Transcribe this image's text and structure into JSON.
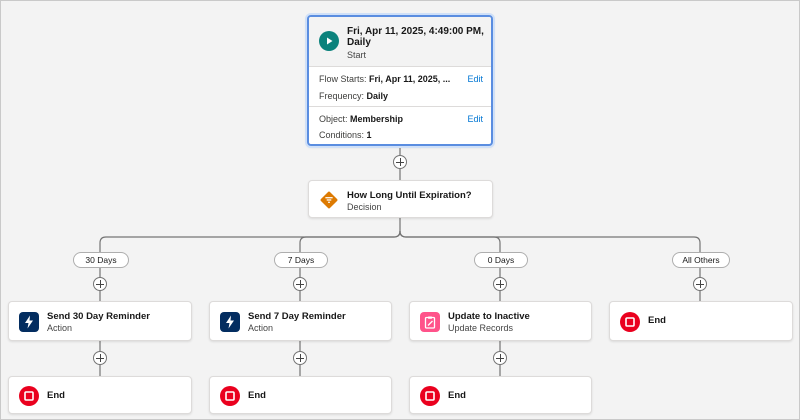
{
  "start": {
    "title": "Fri, Apr 11, 2025, 4:49:00 PM, Daily",
    "subtitle": "Start",
    "icon": "play-icon",
    "flow_starts_label": "Flow Starts:",
    "flow_starts_value": "Fri, Apr 11, 2025, ...",
    "frequency_label": "Frequency:",
    "frequency_value": "Daily",
    "object_label": "Object:",
    "object_value": "Membership",
    "conditions_label": "Conditions:",
    "conditions_value": "1",
    "edit_label": "Edit"
  },
  "decision": {
    "title": "How Long Until Expiration?",
    "subtitle": "Decision",
    "icon": "decision-icon"
  },
  "branches": [
    {
      "label": "30 Days",
      "element": {
        "title": "Send 30 Day Reminder",
        "subtitle": "Action",
        "icon": "lightning-icon"
      },
      "end_label": "End"
    },
    {
      "label": "7 Days",
      "element": {
        "title": "Send 7 Day Reminder",
        "subtitle": "Action",
        "icon": "lightning-icon"
      },
      "end_label": "End"
    },
    {
      "label": "0 Days",
      "element": {
        "title": "Update to Inactive",
        "subtitle": "Update Records",
        "icon": "update-records-icon"
      },
      "end_label": "End"
    },
    {
      "label": "All Others",
      "end_label": "End"
    }
  ],
  "colors": {
    "start_icon": "#0b827c",
    "decision_icon": "#dd7a01",
    "action_icon": "#032d60",
    "update_icon": "#ff538a",
    "end_icon": "#ea001e",
    "connector": "#747474",
    "link": "#0176d3",
    "selection": "#5a8de0"
  }
}
